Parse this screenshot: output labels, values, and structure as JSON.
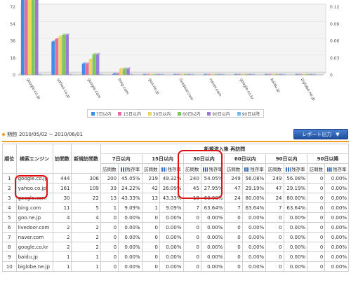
{
  "chart_data": {
    "type": "bar",
    "categories": [
      "google.co.jp",
      "yahoo.co.jp",
      "google.com",
      "bing.com",
      "goo.ne.jp",
      "livedoor.com",
      "naver.com",
      "google.co.kr",
      "baidu.jp",
      "biglobe.ne.jp"
    ],
    "series": [
      {
        "name": "7日以内",
        "values": [
          200,
          39,
          13,
          1,
          0,
          0,
          0,
          0,
          0,
          0
        ]
      },
      {
        "name": "15日以内",
        "values": [
          219,
          42,
          13,
          1,
          0,
          0,
          0,
          0,
          0,
          0
        ]
      },
      {
        "name": "30日以内",
        "values": [
          240,
          45,
          18,
          7,
          0,
          0,
          0,
          0,
          0,
          0
        ]
      },
      {
        "name": "60日以内",
        "values": [
          249,
          47,
          24,
          7,
          0,
          0,
          0,
          0,
          0,
          0
        ]
      },
      {
        "name": "90日以内",
        "values": [
          249,
          47,
          24,
          7,
          0,
          0,
          0,
          0,
          0,
          0
        ]
      },
      {
        "name": "90日以降",
        "values": [
          0,
          0,
          0,
          0,
          0,
          0,
          0,
          0,
          0,
          0
        ]
      }
    ],
    "left_ticks": [
      "0",
      "18",
      "36",
      "54",
      "72"
    ],
    "right_ticks": [
      "0",
      "0.03",
      "0.06",
      "0.09",
      "0.12"
    ],
    "ylim": [
      0,
      80
    ],
    "colors": [
      "#3b8fe8",
      "#e86aa0",
      "#e8d860",
      "#7dc85a",
      "#9a7ad8",
      "#7ab8e8"
    ]
  },
  "legend": [
    "7日以内",
    "15日以内",
    "30日以内",
    "60日以内",
    "90日以内",
    "90日以降"
  ],
  "period": {
    "label": "期間",
    "value": "2010/05/02 ~ 2010/06/01"
  },
  "report_button": {
    "label": "レポート出力",
    "arrow": "▼"
  },
  "table": {
    "headers": {
      "rank": "順位",
      "engine": "検索エンジン",
      "visits": "訪問数",
      "new_visits": "新規訪問数",
      "group": "新規流入後 再訪問",
      "periods": [
        "7日以内",
        "15日以内",
        "30日以内",
        "60日以内",
        "90日以内",
        "90日以降"
      ],
      "sub_visits": "訪問数",
      "sub_rate": "残存率"
    },
    "rows": [
      {
        "rank": "1",
        "engine": "google.co.jp",
        "visits": "444",
        "new": "306",
        "p": [
          [
            "200",
            "45.05%"
          ],
          [
            "219",
            "49.32%"
          ],
          [
            "240",
            "54.05%"
          ],
          [
            "249",
            "56.08%"
          ],
          [
            "249",
            "56.08%"
          ],
          [
            "0",
            "0.00%"
          ]
        ]
      },
      {
        "rank": "2",
        "engine": "yahoo.co.jp",
        "visits": "161",
        "new": "109",
        "p": [
          [
            "39",
            "24.22%"
          ],
          [
            "42",
            "26.09%"
          ],
          [
            "45",
            "27.95%"
          ],
          [
            "47",
            "29.19%"
          ],
          [
            "47",
            "29.19%"
          ],
          [
            "0",
            "0.00%"
          ]
        ]
      },
      {
        "rank": "3",
        "engine": "google.com",
        "visits": "30",
        "new": "22",
        "p": [
          [
            "13",
            "43.33%"
          ],
          [
            "13",
            "43.33%"
          ],
          [
            "18",
            "60.00%"
          ],
          [
            "24",
            "80.00%"
          ],
          [
            "24",
            "80.00%"
          ],
          [
            "0",
            "0.00%"
          ]
        ]
      },
      {
        "rank": "4",
        "engine": "bing.com",
        "visits": "11",
        "new": "5",
        "p": [
          [
            "1",
            "9.09%"
          ],
          [
            "1",
            "9.09%"
          ],
          [
            "7",
            "63.64%"
          ],
          [
            "7",
            "63.64%"
          ],
          [
            "7",
            "63.64%"
          ],
          [
            "0",
            "0.00%"
          ]
        ]
      },
      {
        "rank": "5",
        "engine": "goo.ne.jp",
        "visits": "4",
        "new": "4",
        "p": [
          [
            "0",
            "0.00%"
          ],
          [
            "0",
            "0.00%"
          ],
          [
            "0",
            "0.00%"
          ],
          [
            "0",
            "0.00%"
          ],
          [
            "0",
            "0.00%"
          ],
          [
            "0",
            "0.00%"
          ]
        ]
      },
      {
        "rank": "6",
        "engine": "livedoor.com",
        "visits": "2",
        "new": "2",
        "p": [
          [
            "0",
            "0.00%"
          ],
          [
            "0",
            "0.00%"
          ],
          [
            "0",
            "0.00%"
          ],
          [
            "0",
            "0.00%"
          ],
          [
            "0",
            "0.00%"
          ],
          [
            "0",
            "0.00%"
          ]
        ]
      },
      {
        "rank": "7",
        "engine": "naver.com",
        "visits": "2",
        "new": "2",
        "p": [
          [
            "0",
            "0.00%"
          ],
          [
            "0",
            "0.00%"
          ],
          [
            "0",
            "0.00%"
          ],
          [
            "0",
            "0.00%"
          ],
          [
            "0",
            "0.00%"
          ],
          [
            "0",
            "0.00%"
          ]
        ]
      },
      {
        "rank": "8",
        "engine": "google.co.kr",
        "visits": "2",
        "new": "2",
        "p": [
          [
            "0",
            "0.00%"
          ],
          [
            "0",
            "0.00%"
          ],
          [
            "0",
            "0.00%"
          ],
          [
            "0",
            "0.00%"
          ],
          [
            "0",
            "0.00%"
          ],
          [
            "0",
            "0.00%"
          ]
        ]
      },
      {
        "rank": "9",
        "engine": "baidu.jp",
        "visits": "1",
        "new": "1",
        "p": [
          [
            "0",
            "0.00%"
          ],
          [
            "0",
            "0.00%"
          ],
          [
            "0",
            "0.00%"
          ],
          [
            "0",
            "0.00%"
          ],
          [
            "0",
            "0.00%"
          ],
          [
            "0",
            "0.00%"
          ]
        ]
      },
      {
        "rank": "10",
        "engine": "biglobe.ne.jp",
        "visits": "1",
        "new": "1",
        "p": [
          [
            "0",
            "0.00%"
          ],
          [
            "0",
            "0.00%"
          ],
          [
            "0",
            "0.00%"
          ],
          [
            "0",
            "0.00%"
          ],
          [
            "0",
            "0.00%"
          ],
          [
            "0",
            "0.00%"
          ]
        ]
      }
    ]
  }
}
